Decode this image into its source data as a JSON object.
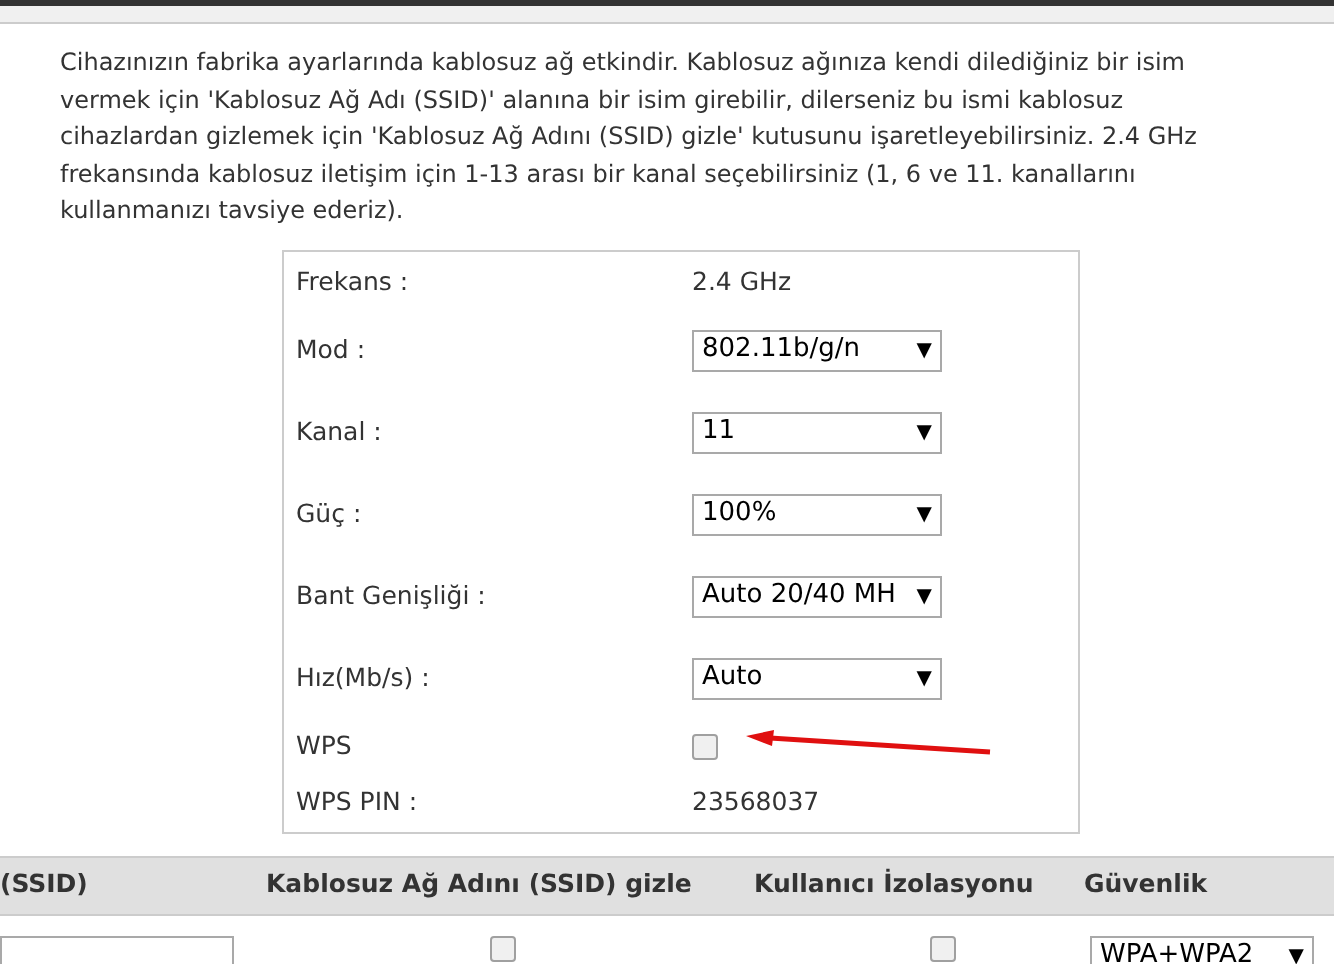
{
  "intro": "Cihazınızın fabrika ayarlarında kablosuz ağ etkindir. Kablosuz ağınıza kendi dilediğiniz bir isim vermek için 'Kablosuz Ağ Adı (SSID)' alanına bir isim girebilir, dilerseniz bu ismi kablosuz cihazlardan gizlemek için 'Kablosuz Ağ Adını (SSID) gizle' kutusunu işaretleyebilirsiniz. 2.4 GHz frekansında kablosuz iletişim için 1-13 arası bir kanal seçebilirsiniz (1, 6 ve 11. kanallarını kullanmanızı tavsiye ederiz).",
  "settings": [
    {
      "kind": "text",
      "label": "Frekans :",
      "value": "2.4 GHz"
    },
    {
      "kind": "select",
      "label": "Mod :",
      "value": "802.11b/g/n",
      "arrow": "▼"
    },
    {
      "kind": "select",
      "label": "Kanal :",
      "value": "11",
      "arrow": "▼"
    },
    {
      "kind": "select",
      "label": "Güç :",
      "value": "100%",
      "arrow": "▼"
    },
    {
      "kind": "select",
      "label": "Bant Genişliği :",
      "value": "Auto 20/40 MH",
      "arrow": "▼"
    },
    {
      "kind": "select",
      "label": "Hız(Mb/s) :",
      "value": "Auto",
      "arrow": "▼"
    },
    {
      "kind": "checkbox",
      "label": "WPS",
      "checked": false
    },
    {
      "kind": "text",
      "label": "WPS PIN :",
      "value": "23568037"
    }
  ],
  "table": {
    "columns": [
      "(SSID)",
      "Kablosuz Ağ Adını (SSID) gizle",
      "Kullanıcı İzolasyonu",
      "Güvenlik"
    ],
    "row": {
      "hide_ssid": false,
      "isolation": false,
      "security": "WPA+WPA2",
      "security_arrow": "▼"
    }
  }
}
